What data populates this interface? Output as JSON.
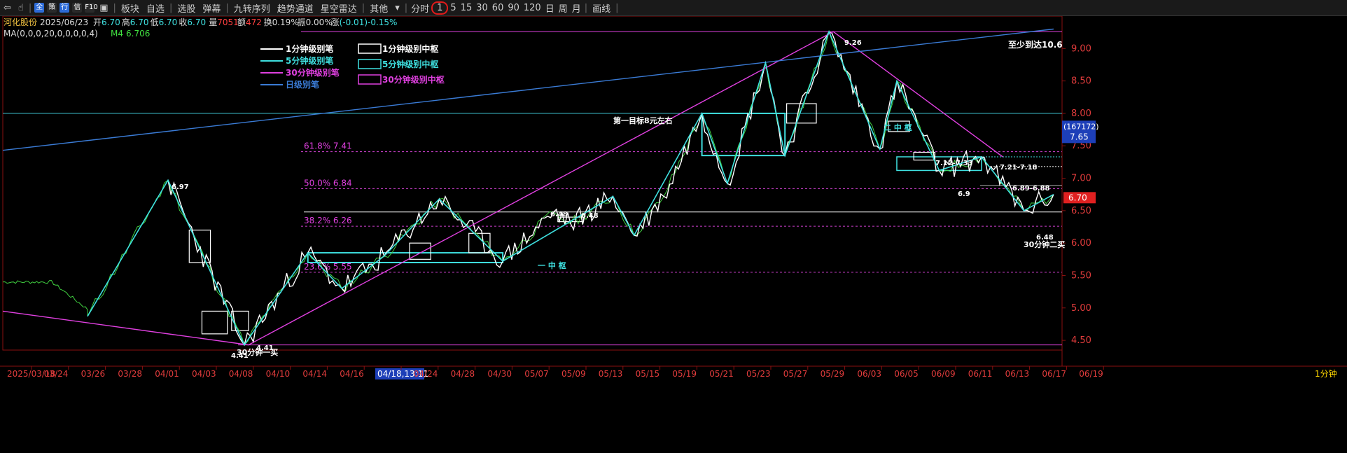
{
  "toolbar": {
    "nav_icons": [
      "back-icon",
      "hand-icon"
    ],
    "badges": [
      {
        "label": "全",
        "bg": "#2d6bd8"
      },
      {
        "label": "策",
        "bg": "#2a2a2a"
      },
      {
        "label": "行",
        "bg": "#2d6bd8"
      },
      {
        "label": "信",
        "bg": "#2a2a2a"
      },
      {
        "label": "F10",
        "bg": "#2a2a2a"
      }
    ],
    "items": [
      "板块",
      "自选",
      "选股",
      "弹幕",
      "九转序列",
      "趋势通道",
      "星空雷达",
      "其他"
    ],
    "periods": [
      "分时",
      "1",
      "5",
      "15",
      "30",
      "60",
      "90",
      "120",
      "日",
      "周",
      "月"
    ],
    "draw": "画线"
  },
  "header": {
    "stock_name": "河化股份",
    "date": "2025/06/23",
    "open_label": "开",
    "open": "6.70",
    "high_label": "高",
    "high": "6.70",
    "low_label": "低",
    "low": "6.70",
    "close_label": "收",
    "close": "6.70",
    "vol_label": "量",
    "vol": "7051",
    "amt_label": "额",
    "amt": "472",
    "turn_label": "换",
    "turn": "0.19%",
    "amp_label": "振",
    "amp": "0.00%",
    "chg_label": "涨",
    "chg": "(-0.01)-0.15%"
  },
  "ma": {
    "params": "MA(0,0,0,20,0,0,0,0,4)",
    "m4_label": "M4",
    "m4_value": "6.706"
  },
  "legend": {
    "left": [
      {
        "label": "1分钟级别笔",
        "color": "#ffffff"
      },
      {
        "label": "5分钟级别笔",
        "color": "#3fe0e0"
      },
      {
        "label": "30分钟级别笔",
        "color": "#e040e0"
      },
      {
        "label": "日级别笔",
        "color": "#3a7bd5"
      }
    ],
    "right": [
      {
        "label": "1分钟级别中枢",
        "color": "#ffffff"
      },
      {
        "label": "5分钟级别中枢",
        "color": "#3fe0e0"
      },
      {
        "label": "30分钟级别中枢",
        "color": "#e040e0"
      }
    ]
  },
  "fib": [
    {
      "label": "61.8% 7.41",
      "price": 7.41
    },
    {
      "label": "50.0% 6.84",
      "price": 6.84
    },
    {
      "label": "38.2% 6.26",
      "price": 6.26
    },
    {
      "label": "23.6% 5.55",
      "price": 5.55
    }
  ],
  "annotations": {
    "target1": "第一目标8元左右",
    "target2": "至少到达10.6",
    "zs1": "一 中 枢",
    "zs2": "二 中 枢",
    "buy1": "30分钟一买",
    "buy2": "30分钟二买",
    "zs_a": "7.12-7.33",
    "zs_b": "7.21-7.18",
    "zs_c": "6.89-6.88",
    "p_697": "6.97",
    "p_926": "9.26",
    "p_441a": "4.41",
    "p_441b": "4.41",
    "p_648a": "6.48",
    "p_648b": "6.48",
    "p_648c": "6.48",
    "p_69": "6.9"
  },
  "chart_data": {
    "type": "line",
    "title": "",
    "ylim": [
      4.35,
      9.5
    ],
    "y_ticks": [
      "9.00",
      "8.50",
      "8.00",
      "7.50",
      "7.00",
      "6.50",
      "6.00",
      "5.50",
      "5.00",
      "4.50"
    ],
    "x_ticks": [
      "2025/03/18",
      "03/24",
      "03/26",
      "03/28",
      "04/01",
      "04/03",
      "04/08",
      "04/10",
      "04/14",
      "04/16",
      "04/18,13:11",
      "04/24",
      "04/28",
      "04/30",
      "05/07",
      "05/09",
      "05/13",
      "05/15",
      "05/19",
      "05/21",
      "05/23",
      "05/27",
      "05/29",
      "06/03",
      "06/05",
      "06/09",
      "06/11",
      "06/13",
      "06/17",
      "06/19"
    ],
    "last_price": "6.70",
    "cursor_price": "7.65",
    "cursor_count": "(167172)",
    "period_label": "1分钟",
    "series": [
      {
        "name": "30分钟级别笔",
        "color": "#e040e0",
        "points": [
          [
            0,
            4.95
          ],
          [
            29,
            4.43
          ],
          [
            98,
            9.26
          ],
          [
            118,
            7.33
          ]
        ]
      },
      {
        "name": "日级别笔",
        "color": "#3a7bd5",
        "points": [
          [
            0,
            7.43
          ],
          [
            124,
            9.3
          ]
        ]
      },
      {
        "name": "5分钟级别笔",
        "color": "#3fe0e0",
        "points": [
          [
            10,
            4.87
          ],
          [
            19.5,
            6.97
          ],
          [
            28.5,
            4.43
          ],
          [
            36,
            5.85
          ],
          [
            40,
            5.3
          ],
          [
            45,
            5.8
          ],
          [
            51.5,
            6.68
          ],
          [
            59,
            5.72
          ],
          [
            72,
            6.72
          ],
          [
            74.5,
            6.12
          ],
          [
            82.5,
            8.0
          ],
          [
            85.5,
            6.92
          ],
          [
            90,
            8.78
          ],
          [
            92.3,
            7.35
          ],
          [
            97.5,
            9.26
          ],
          [
            103.5,
            7.45
          ],
          [
            105.5,
            8.5
          ],
          [
            110.5,
            7.12
          ],
          [
            115.5,
            7.33
          ],
          [
            120.5,
            6.5
          ],
          [
            124,
            6.75
          ]
        ]
      }
    ]
  }
}
